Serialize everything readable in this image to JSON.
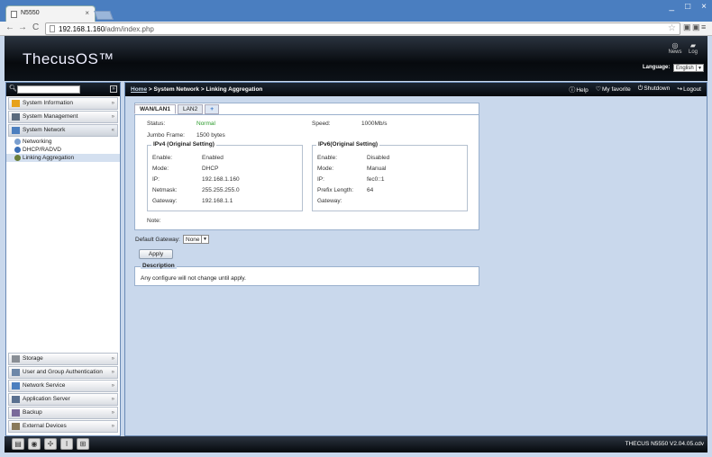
{
  "browser": {
    "tab_title": "N5550",
    "tab_close": "×",
    "win_min": "_",
    "win_max": "□",
    "win_close": "×",
    "back": "←",
    "forward": "→",
    "reload": "C",
    "url_host": "192.168.1.160",
    "url_path": "/adm/index.php",
    "star": "☆",
    "ext": "▣",
    "ext2": "▣",
    "menu": "≡"
  },
  "header": {
    "logo": "ThecusOS™",
    "news": "News",
    "log": "Log",
    "language_label": "Language:",
    "language_value": "English"
  },
  "sidebar": {
    "search_placeholder": "",
    "categories_top": [
      {
        "label": "System Information",
        "icon": "info-icon",
        "color": "#e7a21a"
      },
      {
        "label": "System Management",
        "icon": "tools-icon",
        "color": "#5b6b7d"
      },
      {
        "label": "System Network",
        "icon": "network-icon",
        "color": "#4c7fbf"
      }
    ],
    "subitems": [
      {
        "label": "Networking"
      },
      {
        "label": "DHCP/RADVD"
      },
      {
        "label": "Linking Aggregation"
      }
    ],
    "categories_bottom": [
      {
        "label": "Storage"
      },
      {
        "label": "User and Group Authentication"
      },
      {
        "label": "Network Service"
      },
      {
        "label": "Application Server"
      },
      {
        "label": "Backup"
      },
      {
        "label": "External Devices"
      }
    ]
  },
  "main": {
    "breadcrumb_home": "Home",
    "breadcrumb_rest": " > System Network > Linking Aggregation",
    "help": "Help",
    "favorite": "My favorite",
    "shutdown": "Shutdown",
    "logout": "Logout",
    "tabs": [
      "WAN/LAN1",
      "LAN2",
      "+"
    ],
    "status_label": "Status:",
    "status_value": "Normal",
    "speed_label": "Speed:",
    "speed_value": "1000Mb/s",
    "jumbo_label": "Jumbo Frame:",
    "jumbo_value": "1500 bytes",
    "ipv4": {
      "title": "IPv4 (Original Setting)",
      "rows": [
        {
          "label": "Enable:",
          "value": "Enabled"
        },
        {
          "label": "Mode:",
          "value": "DHCP"
        },
        {
          "label": "IP:",
          "value": "192.168.1.160"
        },
        {
          "label": "Netmask:",
          "value": "255.255.255.0"
        },
        {
          "label": "Gateway:",
          "value": "192.168.1.1"
        }
      ]
    },
    "ipv6": {
      "title": "IPv6(Original Setting)",
      "rows": [
        {
          "label": "Enable:",
          "value": "Disabled"
        },
        {
          "label": "Mode:",
          "value": "Manual"
        },
        {
          "label": "IP:",
          "value": "fec0::1"
        },
        {
          "label": "Prefix Length:",
          "value": "64"
        },
        {
          "label": "Gateway:",
          "value": ""
        }
      ]
    },
    "note_label": "Note:",
    "default_gateway_label": "Default Gateway:",
    "default_gateway_value": "None",
    "apply_label": "Apply",
    "description_title": "Description",
    "description_text": "Any configure will not change until apply."
  },
  "footer": {
    "version": "THECUS N5550 V2.04.05.cdv"
  }
}
